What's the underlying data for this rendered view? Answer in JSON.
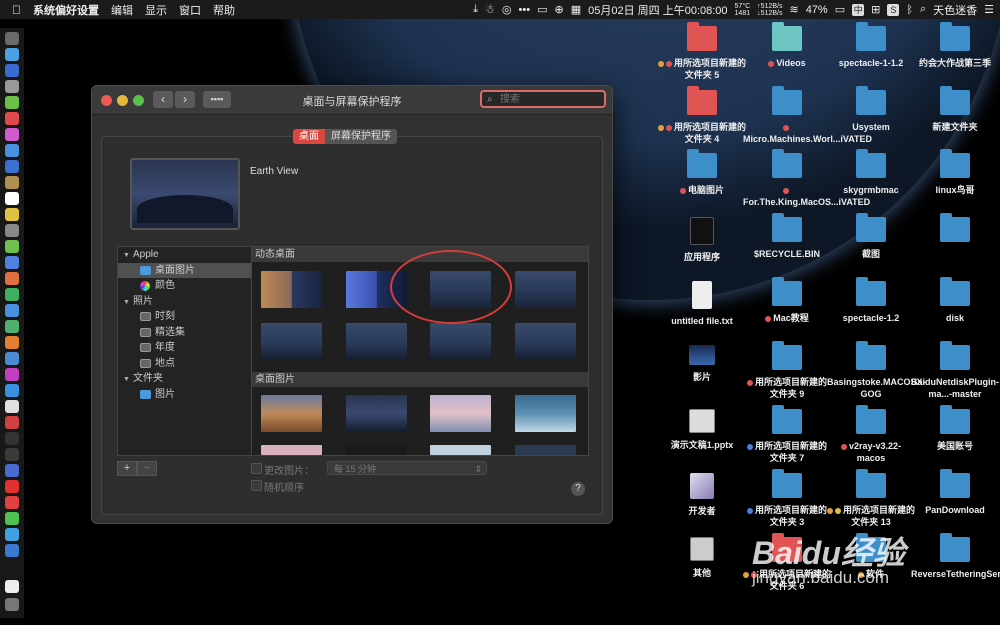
{
  "menubar": {
    "app": "系统偏好设置",
    "menus": [
      "编辑",
      "显示",
      "窗口",
      "帮助"
    ],
    "temp": "57°C",
    "rpm": "1481",
    "net_up": "↑512B/s",
    "net_down": "↓512B/s",
    "datetime": "05月02日 周四 上午00:08:00",
    "battery": "47%",
    "input": "中",
    "s_letter": "S",
    "user": "天色迷香"
  },
  "window": {
    "title": "桌面与屏幕保护程序",
    "search_placeholder": "搜索",
    "tab_desktop": "桌面",
    "tab_screensaver": "屏幕保护程序",
    "preview_name": "Earth View",
    "tree": [
      {
        "label": "Apple",
        "type": "group"
      },
      {
        "label": "桌面图片",
        "type": "folder",
        "selected": true
      },
      {
        "label": "颜色",
        "type": "color"
      },
      {
        "label": "照片",
        "type": "group"
      },
      {
        "label": "时刻",
        "type": "album"
      },
      {
        "label": "精选集",
        "type": "album"
      },
      {
        "label": "年度",
        "type": "album"
      },
      {
        "label": "地点",
        "type": "album"
      },
      {
        "label": "文件夹",
        "type": "group"
      },
      {
        "label": "图片",
        "type": "folder"
      }
    ],
    "section_dynamic": "动态桌面",
    "section_pictures": "桌面图片",
    "add_button": "+",
    "remove_button": "−",
    "change_picture": "更改图片：",
    "interval": "每 15 分钟",
    "random_order": "随机顺序",
    "help": "?"
  },
  "desktop_icons": [
    {
      "name": "用所选项目新建的文件夹 5",
      "kind": "folder-red",
      "tags": [
        "#e0a040",
        "#e05454"
      ]
    },
    {
      "name": "Videos",
      "kind": "folder-teal",
      "tags": [
        "#e05454"
      ]
    },
    {
      "name": "spectacle-1-1.2",
      "kind": "folder",
      "tags": []
    },
    {
      "name": "约会大作战第三季",
      "kind": "folder",
      "tags": []
    },
    {
      "name": "用所选项目新建的文件夹 4",
      "kind": "folder-red",
      "tags": [
        "#e0a040",
        "#e05454"
      ]
    },
    {
      "name": "Micro.Machines.Worl...iVATED",
      "kind": "folder",
      "tags": [
        "#e05454"
      ]
    },
    {
      "name": "Usystem",
      "kind": "folder",
      "tags": []
    },
    {
      "name": "新建文件夹",
      "kind": "folder",
      "tags": []
    },
    {
      "name": "电脑图片",
      "kind": "folder",
      "tags": [
        "#e05454"
      ]
    },
    {
      "name": "For.The.King.MacOS...iVATED",
      "kind": "folder",
      "tags": [
        "#e05454"
      ]
    },
    {
      "name": "skygrmbmac",
      "kind": "folder",
      "tags": []
    },
    {
      "name": "linux鸟哥",
      "kind": "folder",
      "tags": []
    },
    {
      "name": "应用程序",
      "kind": "terminal",
      "tags": []
    },
    {
      "name": "$RECYCLE.BIN",
      "kind": "folder",
      "tags": []
    },
    {
      "name": "截图",
      "kind": "folder",
      "tags": []
    },
    {
      "name": "",
      "kind": "folder",
      "tags": []
    },
    {
      "name": "untitled file.txt",
      "kind": "file",
      "tags": []
    },
    {
      "name": "Mac教程",
      "kind": "folder",
      "tags": [
        "#e05454"
      ]
    },
    {
      "name": "spectacle-1.2",
      "kind": "folder",
      "tags": []
    },
    {
      "name": "disk",
      "kind": "folder",
      "tags": []
    },
    {
      "name": "影片",
      "kind": "movie",
      "tags": []
    },
    {
      "name": "用所选项目新建的文件夹 9",
      "kind": "folder",
      "tags": [
        "#e05454"
      ]
    },
    {
      "name": "Basingstoke.MACOSX-GOG",
      "kind": "folder",
      "tags": []
    },
    {
      "name": "BaiduNetdiskPlugin-ma...-master",
      "kind": "folder",
      "tags": []
    },
    {
      "name": "演示文稿1.pptx",
      "kind": "pptx",
      "tags": []
    },
    {
      "name": "用所选项目新建的文件夹 7",
      "kind": "folder",
      "tags": [
        "#4a7ee0"
      ]
    },
    {
      "name": "v2ray-v3.22-macos",
      "kind": "folder",
      "tags": [
        "#e05454"
      ]
    },
    {
      "name": "美国账号",
      "kind": "folder",
      "tags": []
    },
    {
      "name": "开发者",
      "kind": "dev",
      "tags": []
    },
    {
      "name": "用所选项目新建的文件夹 3",
      "kind": "folder",
      "tags": [
        "#4a7ee0"
      ]
    },
    {
      "name": "用所选项目新建的文件夹 13",
      "kind": "folder",
      "tags": [
        "#e0a040",
        "#e0c040"
      ]
    },
    {
      "name": "PanDownload",
      "kind": "folder",
      "tags": []
    },
    {
      "name": "其他",
      "kind": "misc",
      "tags": []
    },
    {
      "name": "用所选项目新建的文件夹 6",
      "kind": "folder-red",
      "tags": [
        "#e0a040",
        "#e05454"
      ]
    },
    {
      "name": "软件",
      "kind": "folder",
      "tags": [
        "#e0a040"
      ]
    },
    {
      "name": "ReverseTetheringServer_1.2.0",
      "kind": "folder",
      "tags": []
    }
  ],
  "watermark": {
    "logo": "Baidu经验",
    "url": "jingyan.baidu.com"
  }
}
